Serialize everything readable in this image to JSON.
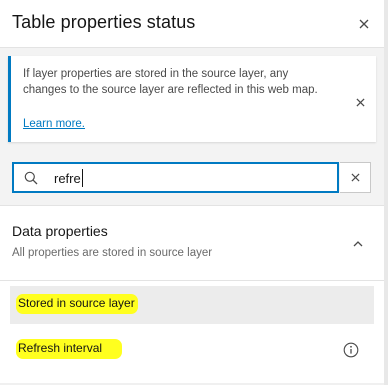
{
  "header": {
    "title": "Table properties status",
    "close_icon": "close-icon"
  },
  "notice": {
    "message": "If layer properties are stored in the source layer, any changes to the source layer are reflected in this web map.",
    "link": "Learn more.",
    "accent_color": "#007ac2",
    "close_icon": "close-icon"
  },
  "search": {
    "value": "refre",
    "icon": "search-icon",
    "clear_icon": "close-icon"
  },
  "section": {
    "title": "Data properties",
    "subtitle": "All properties are stored in source layer",
    "expand_icon": "chevron-up-icon",
    "items": [
      {
        "label": "Stored in source layer",
        "highlight_color": "#ffff1f"
      },
      {
        "label": "Refresh interval",
        "highlight_color": "#ffff1f",
        "icon": "info-icon"
      }
    ]
  }
}
